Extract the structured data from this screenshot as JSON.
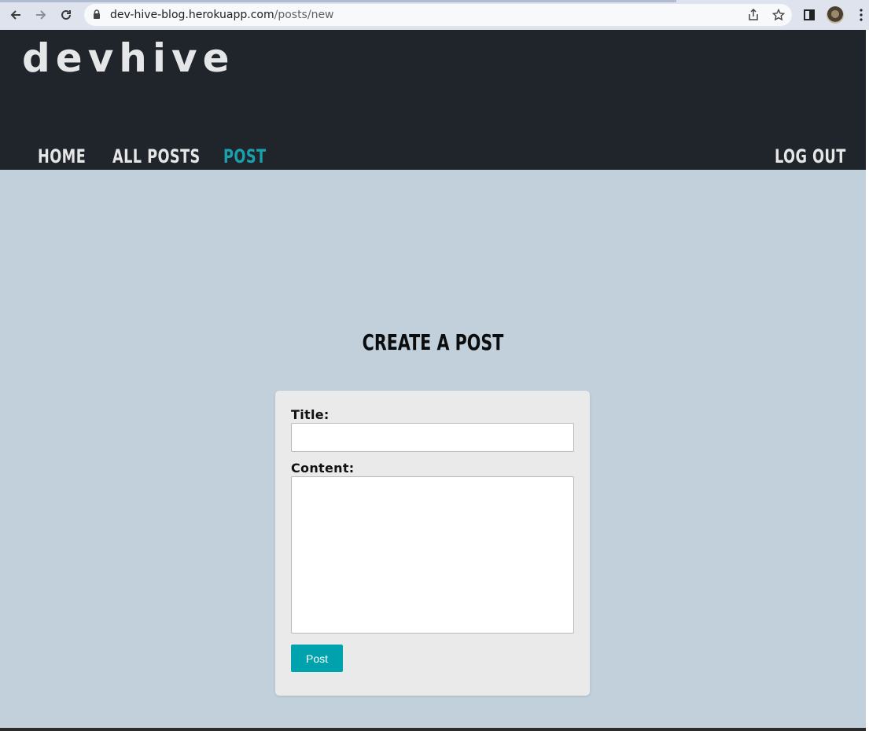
{
  "browser": {
    "url_host": "dev-hive-blog.herokuapp.com",
    "url_path": "/posts/new",
    "icons": {
      "back": "arrow-left-icon",
      "forward": "arrow-right-icon",
      "reload": "reload-icon",
      "lock": "lock-icon",
      "share": "share-icon",
      "bookmark": "star-icon",
      "side_panel": "side-panel-icon",
      "menu": "kebab-menu-icon"
    }
  },
  "site": {
    "logo": "devhive",
    "nav": {
      "home": "Home",
      "all_posts": "All Posts",
      "post": "Post",
      "logout": "Log Out"
    },
    "active_nav": "post"
  },
  "main": {
    "heading": "Create a Post",
    "form": {
      "title_label": "Title:",
      "title_value": "",
      "content_label": "Content:",
      "content_value": "",
      "submit_label": "Post"
    }
  },
  "colors": {
    "header_bg": "#20242b",
    "page_bg": "#c1d0da",
    "accent": "#00a3ad",
    "card_bg": "#eaeaea"
  }
}
